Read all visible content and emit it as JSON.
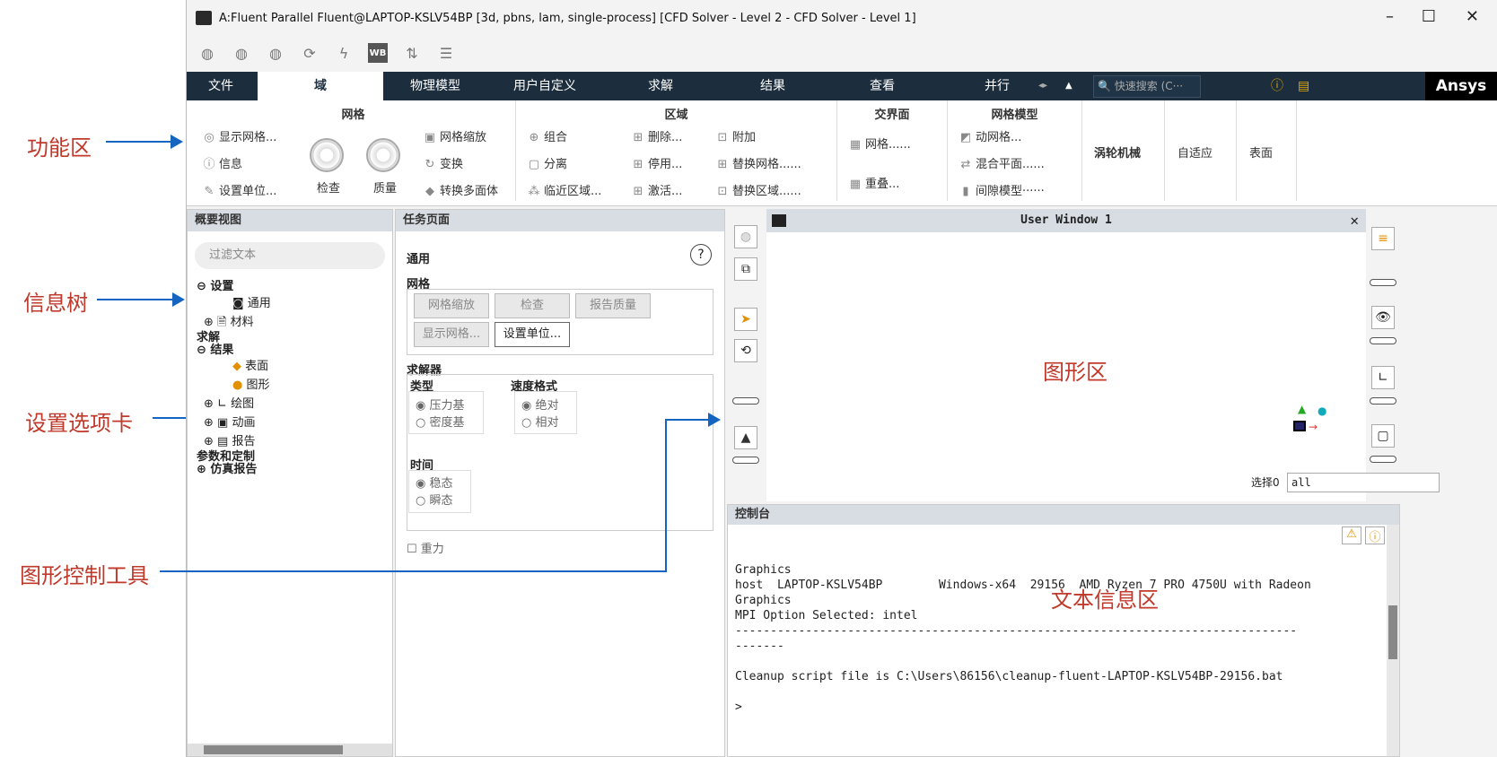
{
  "annotations": {
    "ribbon": "功能区",
    "tree": "信息树",
    "settings": "设置选项卡",
    "graphics_tools": "图形控制工具",
    "graphics": "图形区",
    "text": "文本信息区"
  },
  "title": "A:Fluent Parallel Fluent@LAPTOP-KSLV54BP  [3d, pbns, lam, single-process] [CFD Solver - Level 2 - CFD Solver - Level 1]",
  "window_controls": {
    "min": "–",
    "max": "☐",
    "close": "✕"
  },
  "qat": {
    "wb": "WB"
  },
  "tabs": [
    "文件",
    "域",
    "物理模型",
    "用户自定义",
    "求解",
    "结果",
    "查看",
    "并行"
  ],
  "search_placeholder": "快速搜索 (C···",
  "brand": "Ansys",
  "ribbon": {
    "mesh": {
      "title": "网格",
      "display": "显示网格...",
      "info": "信息",
      "units": "设置单位...",
      "check": "检查",
      "quality": "质量",
      "scale": "网格缩放",
      "transform": "变换",
      "poly": "转换多面体"
    },
    "zones": {
      "title": "区域",
      "combine": "组合",
      "separate": "分离",
      "adjacency": "临近区域...",
      "delete": "删除...",
      "deactivate": "停用...",
      "activate": "激活...",
      "append": "附加",
      "replace_mesh": "替换网格......",
      "replace_zone": "替换区域......"
    },
    "interface": {
      "title": "交界面",
      "mesh": "网格......",
      "overlap": "重叠..."
    },
    "meshmodel": {
      "title": "网格模型",
      "dynamic": "动网格...",
      "mixing": "混合平面......",
      "gap": "间隙模型······"
    },
    "turbo": "涡轮机械",
    "adapt": "自适应",
    "surface": "表面"
  },
  "outline": {
    "title": "概要视图",
    "filter": "过滤文本",
    "items": [
      "设置",
      "通用",
      "材料",
      "求解",
      "结果",
      "表面",
      "图形",
      "绘图",
      "动画",
      "报告",
      "参数和定制",
      "仿真报告"
    ]
  },
  "task": {
    "title": "任务页面",
    "section": "通用",
    "mesh": "网格",
    "btn_scale": "网格缩放",
    "btn_check": "检查",
    "btn_quality": "报告质量",
    "btn_display": "显示网格...",
    "btn_units": "设置单位...",
    "solver": "求解器",
    "type": "类型",
    "velocity": "速度格式",
    "pressure": "压力基",
    "density": "密度基",
    "absolute": "绝对",
    "relative": "相对",
    "time": "时间",
    "steady": "稳态",
    "transient": "瞬态",
    "gravity": "重力"
  },
  "graphics": {
    "window": "User Window 1",
    "select_label": "选择0",
    "select_value": "all"
  },
  "console": {
    "title": "控制台",
    "lines": [
      "Graphics",
      "host  LAPTOP-KSLV54BP        Windows-x64  29156  AMD Ryzen 7 PRO 4750U with Radeon",
      "Graphics",
      "",
      "MPI Option Selected: intel",
      "--------------------------------------------------------------------------------",
      "-------",
      "",
      "Cleanup script file is C:\\Users\\86156\\cleanup-fluent-LAPTOP-KSLV54BP-29156.bat",
      "",
      ">"
    ]
  }
}
